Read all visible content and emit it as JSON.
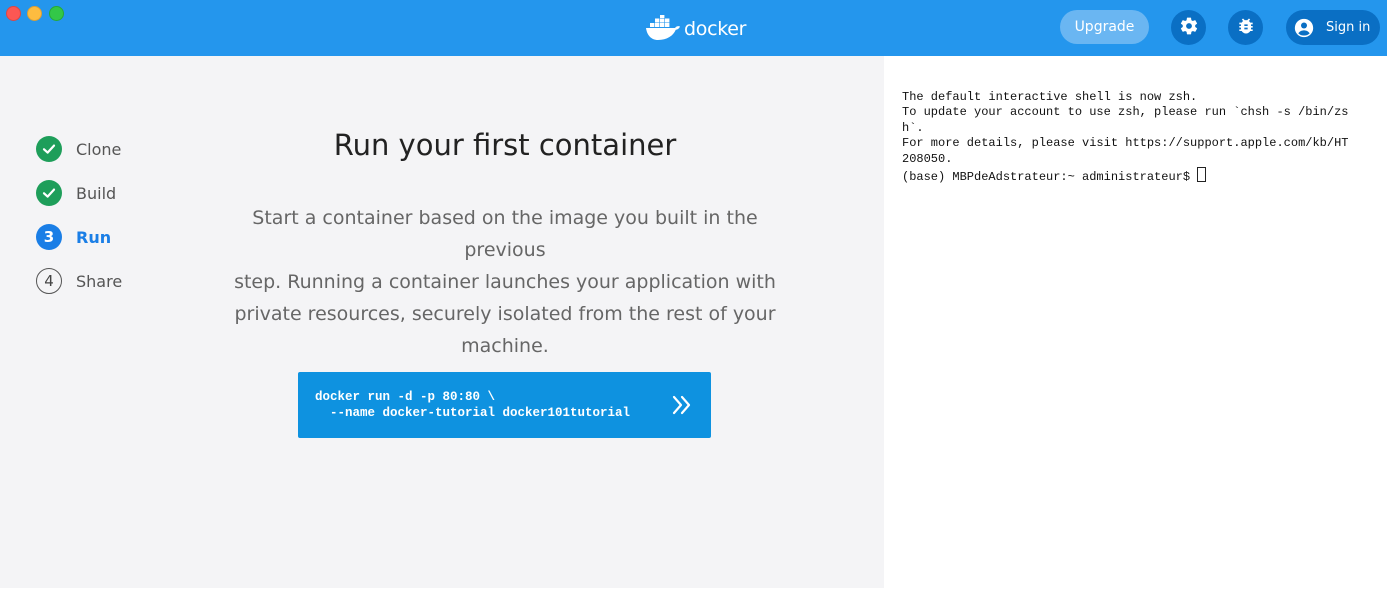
{
  "app": {
    "logo_text": "docker",
    "upgrade_label": "Upgrade",
    "signin_label": "Sign in"
  },
  "stepper": {
    "steps": [
      {
        "label": "Clone",
        "state": "done"
      },
      {
        "label": "Build",
        "state": "done"
      },
      {
        "label": "Run",
        "number": "3",
        "state": "active"
      },
      {
        "label": "Share",
        "number": "4",
        "state": "todo"
      }
    ]
  },
  "main": {
    "title": "Run your first container",
    "description_lines": [
      "Start a container based on the image you built in the previous",
      "step. Running a container launches your application with",
      "private resources, securely isolated from the rest of your",
      "machine."
    ],
    "command_lines": [
      "docker run -d -p 80:80 \\",
      "  --name docker-tutorial docker101tutorial"
    ]
  },
  "terminal": {
    "lines": [
      "The default interactive shell is now zsh.",
      "To update your account to use zsh, please run `chsh -s /bin/zs",
      "h`.",
      "For more details, please visit https://support.apple.com/kb/HT",
      "208050."
    ],
    "prompt": "(base) MBPdeAdstrateur:~ administrateur$ "
  },
  "colors": {
    "brand_blue": "#2496ed",
    "dark_blue_button": "#0a6fc4",
    "command_blue": "#0e92e0",
    "active_step": "#1a7ee6",
    "done_step": "#1e9e5a"
  },
  "icons": {
    "settings": "gear-icon",
    "bug": "bug-icon",
    "user": "user-circle-icon",
    "run": "double-chevron-right-icon",
    "done": "check-circle-icon",
    "logo": "docker-whale-icon"
  }
}
